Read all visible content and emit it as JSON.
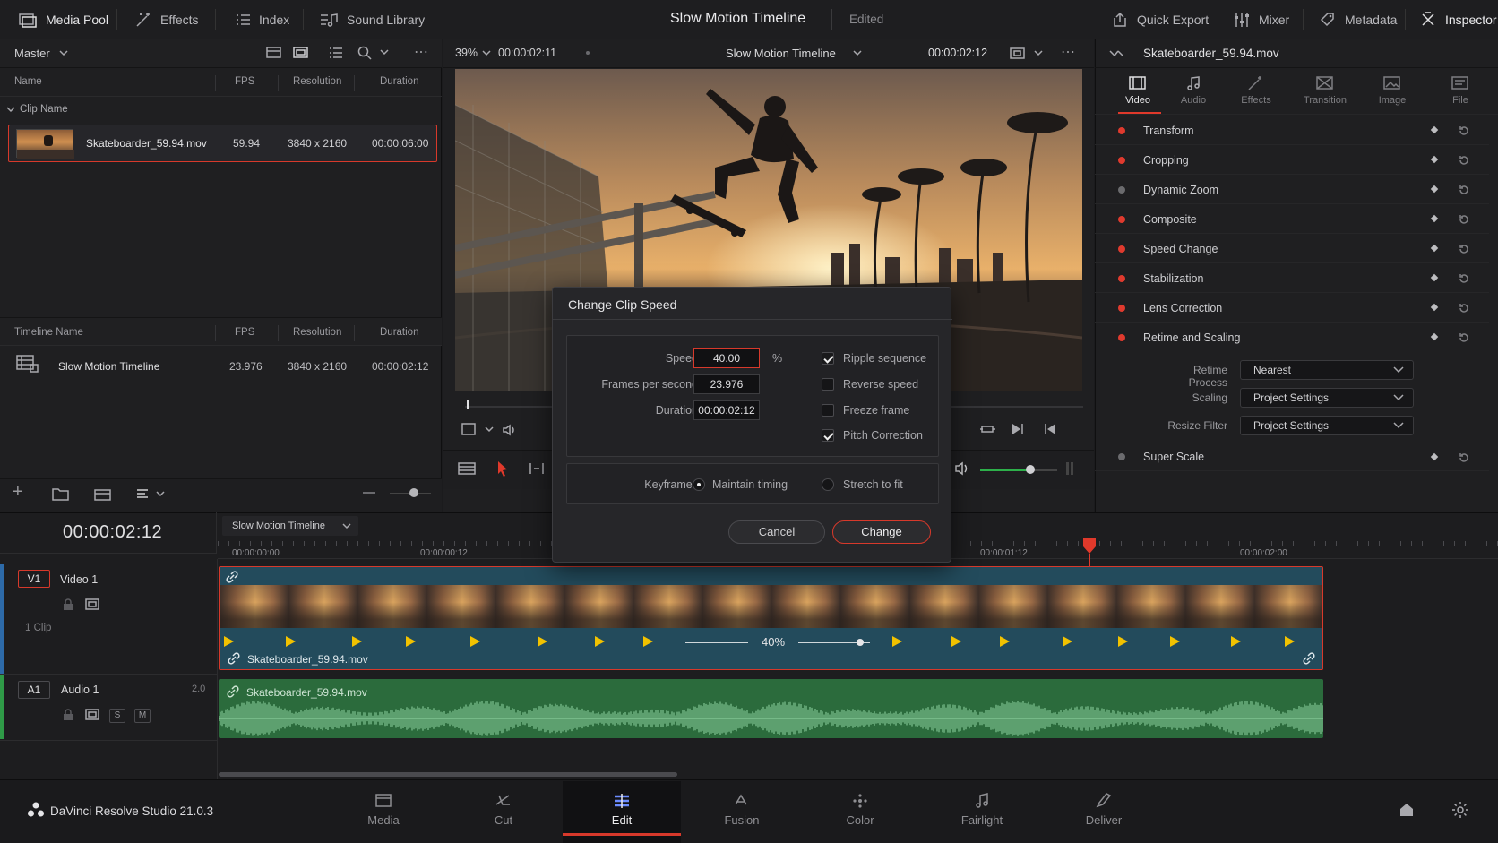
{
  "topbar": {
    "media_pool": "Media Pool",
    "effects": "Effects",
    "index": "Index",
    "sound_library": "Sound Library",
    "timeline_title": "Slow Motion Timeline",
    "status": "Edited",
    "quick_export": "Quick Export",
    "mixer": "Mixer",
    "metadata": "Metadata",
    "inspector": "Inspector"
  },
  "media_pool": {
    "bin": "Master",
    "columns": [
      "Name",
      "FPS",
      "Resolution",
      "Duration"
    ],
    "group_label": "Clip Name",
    "clip": {
      "name": "Skateboarder_59.94.mov",
      "fps": "59.94",
      "resolution": "3840 x 2160",
      "duration": "00:00:06:00"
    },
    "timeline_columns": [
      "Timeline Name",
      "FPS",
      "Resolution",
      "Duration"
    ],
    "timeline": {
      "name": "Slow Motion Timeline",
      "fps": "23.976",
      "resolution": "3840 x 2160",
      "duration": "00:00:02:12"
    }
  },
  "viewer": {
    "zoom": "39%",
    "timecode_left": "00:00:02:11",
    "title": "Slow Motion Timeline",
    "timecode_right": "00:00:02:12"
  },
  "inspector": {
    "clip_name": "Skateboarder_59.94.mov",
    "tabs": [
      "Video",
      "Audio",
      "Effects",
      "Transition",
      "Image",
      "File"
    ],
    "active_tab": "Video",
    "sections": [
      {
        "label": "Transform",
        "on": true
      },
      {
        "label": "Cropping",
        "on": true
      },
      {
        "label": "Dynamic Zoom",
        "on": false
      },
      {
        "label": "Composite",
        "on": true
      },
      {
        "label": "Speed Change",
        "on": true
      },
      {
        "label": "Stabilization",
        "on": true
      },
      {
        "label": "Lens Correction",
        "on": true
      },
      {
        "label": "Retime and Scaling",
        "on": true
      }
    ],
    "retime_process_label": "Retime Process",
    "retime_process": "Nearest",
    "scaling_label": "Scaling",
    "scaling": "Project Settings",
    "resize_filter_label": "Resize Filter",
    "resize_filter": "Project Settings",
    "super_scale": "Super Scale"
  },
  "dialog": {
    "title": "Change Clip Speed",
    "speed_label": "Speed",
    "speed": "40.00",
    "speed_unit": "%",
    "fps_label": "Frames per second",
    "fps": "23.976",
    "duration_label": "Duration",
    "duration": "00:00:02:12",
    "ripple": "Ripple sequence",
    "reverse": "Reverse speed",
    "freeze": "Freeze frame",
    "pitch": "Pitch Correction",
    "keyframes_label": "Keyframes",
    "maintain": "Maintain timing",
    "stretch": "Stretch to fit",
    "cancel": "Cancel",
    "change": "Change"
  },
  "timeline": {
    "timecode": "00:00:02:12",
    "name": "Slow Motion Timeline",
    "ruler": [
      "00:00:00:00",
      "00:00:00:12",
      "00:00:01:12",
      "00:00:02:00"
    ],
    "v1": "V1",
    "video_track": "Video 1",
    "clip_count": "1 Clip",
    "clip_name": "Skateboarder_59.94.mov",
    "speed_badge": "40%",
    "a1": "A1",
    "audio_track": "Audio 1",
    "audio_channels": "2.0",
    "solo": "S",
    "mute": "M",
    "audio_clip_name": "Skateboarder_59.94.mov"
  },
  "bottom": {
    "app": "DaVinci Resolve Studio 21.0.3",
    "pages": [
      "Media",
      "Cut",
      "Edit",
      "Fusion",
      "Color",
      "Fairlight",
      "Deliver"
    ],
    "active": "Edit"
  }
}
